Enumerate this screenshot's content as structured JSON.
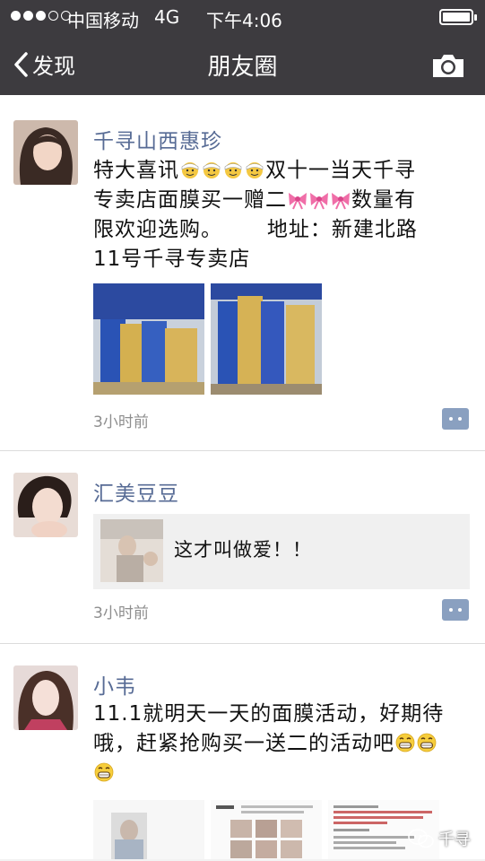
{
  "status_bar": {
    "carrier": "中国移动",
    "network": "4G",
    "time": "下午4:06",
    "signal_bars_filled": 3,
    "signal_bars_total": 5
  },
  "nav": {
    "back_label": "发现",
    "title": "朋友圈"
  },
  "posts": [
    {
      "author": "千寻山西惠珍",
      "text_lines": [
        "特大喜讯",
        "双十一当天千寻",
        "专卖店面膜买一赠二",
        "数量有",
        "限欢迎选购。      地址：新建北路",
        "11号千寻专卖店"
      ],
      "time_ago": "3小时前",
      "emojis": [
        "mask-face-emoji",
        "ribbon-bow-emoji"
      ]
    },
    {
      "author": "汇美豆豆",
      "share_text": "这才叫做爱！！",
      "time_ago": "3小时前"
    },
    {
      "author": "小韦",
      "text_lines": [
        "11.1就明天一天的面膜活动，好期待",
        "哦，赶紧抢购买一送二的活动吧"
      ],
      "emojis": [
        "grinning-face-emoji"
      ]
    }
  ],
  "watermark": "千寻",
  "colors": {
    "bar_bg": "#3d3b3f",
    "name_blue": "#576b95",
    "feed_bg": "#f2f2f2"
  }
}
